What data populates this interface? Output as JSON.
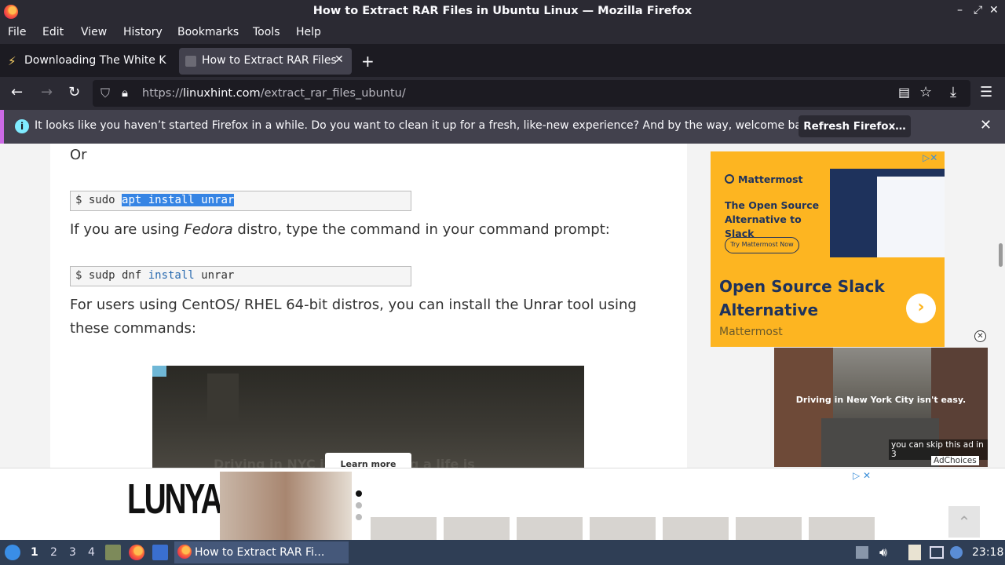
{
  "window": {
    "title": "How to Extract RAR Files in Ubuntu Linux — Mozilla Firefox",
    "controls": [
      "–",
      "⤢",
      "✕"
    ]
  },
  "menu": [
    "File",
    "Edit",
    "View",
    "History",
    "Bookmarks",
    "Tools",
    "Help"
  ],
  "tabs": [
    {
      "label": "Downloading The White K",
      "active": false
    },
    {
      "label": "How to Extract RAR Files",
      "active": true
    }
  ],
  "new_tab": "+",
  "nav": {
    "url_scheme": "https://",
    "url_host": "linuxhint.com",
    "url_path": "/extract_rar_files_ubuntu/"
  },
  "notification": {
    "message": "It looks like you haven’t started Firefox in a while. Do you want to clean it up for a fresh, like-new experience? And by the way, welcome back!",
    "button": "Refresh Firefox…"
  },
  "article": {
    "or_text": "Or",
    "cmd1_prefix": "$ sudo ",
    "cmd1_selected": "apt install unrar",
    "para1_before": "If you are using ",
    "para1_em": "Fedora",
    "para1_after": " distro, type the command in your command prompt:",
    "cmd2_prefix": "$ sudp dnf ",
    "cmd2_kw": "install",
    "cmd2_after": " unrar",
    "para2_line1": "For users using CentOS/ RHEL 64-bit distros, you can install the Unrar tool using",
    "para2_line2": "these commands:",
    "video_learn": "Learn more",
    "video_faint": "Driving in NYC isn't... driving a life is"
  },
  "ads": {
    "mattermost": {
      "brand": "Mattermost",
      "headline": "The Open Source Alternative to Slack",
      "cta": "Try Mattermost Now",
      "big": "Open Source Slack Alternative",
      "source": "Mattermost"
    },
    "video_ad": {
      "caption": "Driving in New York City isn't easy.",
      "skip": "you can skip this ad in 3",
      "choices": "AdChoices"
    },
    "bottom": {
      "logo": "LUNYA"
    }
  },
  "taskbar": {
    "workspaces": [
      "1",
      "2",
      "3",
      "4"
    ],
    "app_label": "How to Extract RAR Fi...",
    "clock": "23:18"
  }
}
